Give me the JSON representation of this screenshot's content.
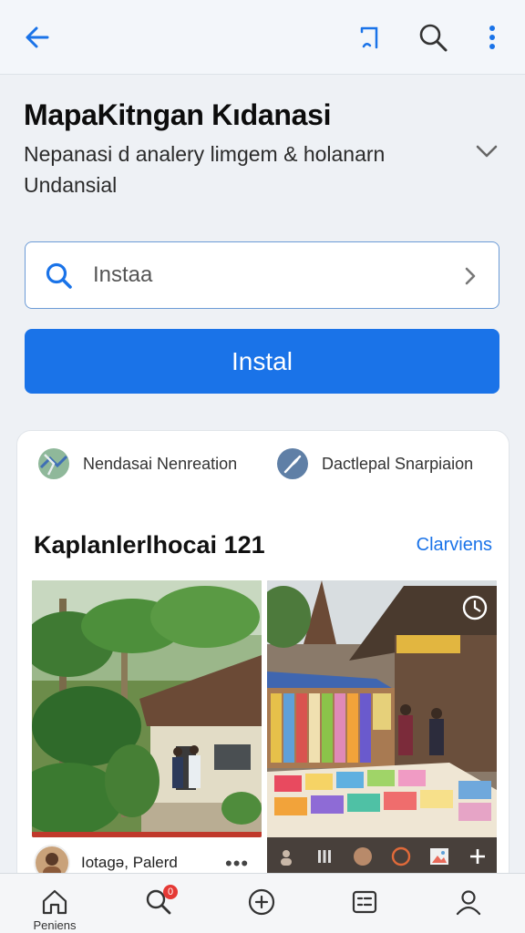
{
  "topbar": {
    "back_icon": "arrow-left-icon",
    "bookmark_icon": "bookmark-icon",
    "search_icon": "search-icon",
    "more_icon": "more-vertical-icon"
  },
  "header": {
    "title": "MapaKitngan Kıdanasi",
    "subtitle": "Nepanasi d analery limgem & holanarn Undansial"
  },
  "search": {
    "value": "Instaa"
  },
  "install": {
    "label": "Instal",
    "color": "#1a73e8"
  },
  "card": {
    "chips": [
      {
        "label": "Nendasai Nenreation",
        "icon": "map-icon"
      },
      {
        "label": "Dactlepal Snarpiaion",
        "icon": "feather-icon"
      }
    ],
    "section_title": "Kaplanlerlhocai 121",
    "section_link": "Clarviens",
    "photos": [
      {
        "name": "tropical-village-photo"
      },
      {
        "name": "textile-market-photo"
      }
    ],
    "caption": "Iotagə, Palerd",
    "caption_more": "•••"
  },
  "bottom_nav": {
    "items": [
      {
        "label": "Peniens",
        "icon": "home-icon"
      },
      {
        "label": "",
        "icon": "search-icon",
        "badge": "0"
      },
      {
        "label": "",
        "icon": "add-circle-icon"
      },
      {
        "label": "",
        "icon": "list-icon"
      },
      {
        "label": "",
        "icon": "profile-icon"
      }
    ]
  }
}
